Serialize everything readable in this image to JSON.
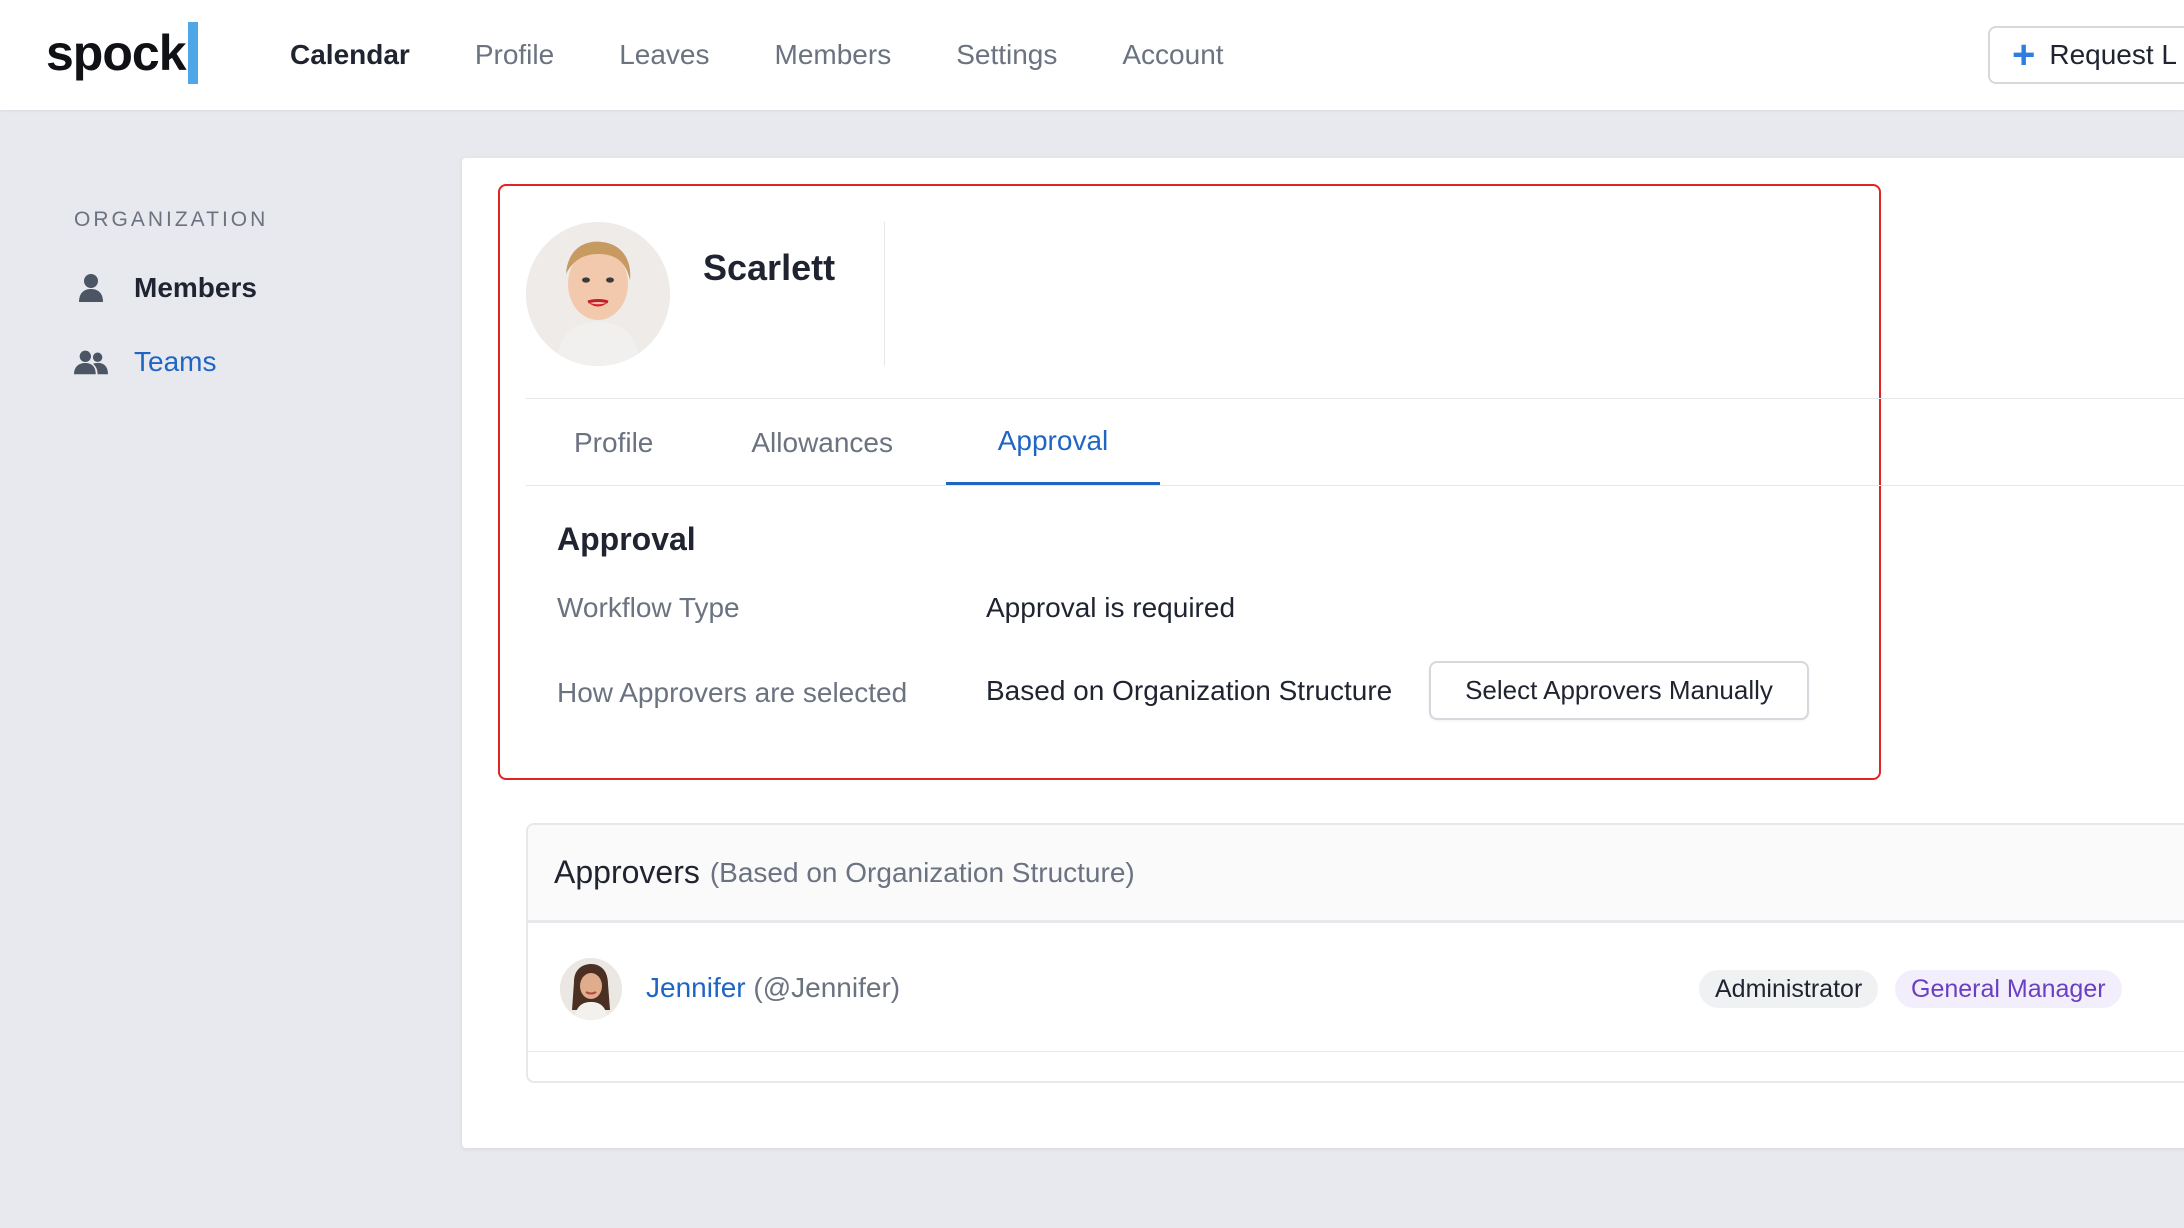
{
  "brand": {
    "name": "spock",
    "accent": "#4fa7e8"
  },
  "nav": {
    "items": [
      "Calendar",
      "Profile",
      "Leaves",
      "Members",
      "Settings",
      "Account"
    ],
    "active": "Calendar",
    "request_button": "Request L"
  },
  "sidebar": {
    "heading": "ORGANIZATION",
    "items": [
      {
        "label": "Members",
        "icon": "user-icon",
        "active": true
      },
      {
        "label": "Teams",
        "icon": "users-icon",
        "active": false
      }
    ]
  },
  "member": {
    "name": "Scarlett"
  },
  "tabs": {
    "items": [
      "Profile",
      "Allowances",
      "Approval"
    ],
    "active": "Approval"
  },
  "approval": {
    "title": "Approval",
    "workflow_label": "Workflow Type",
    "workflow_value": "Approval is required",
    "selection_label": "How Approvers are selected",
    "selection_value": "Based on Organization Structure",
    "manual_button": "Select Approvers Manually"
  },
  "approvers": {
    "title": "Approvers",
    "subtitle": "(Based on Organization Structure)",
    "list": [
      {
        "name": "Jennifer",
        "handle": "(@Jennifer)",
        "badges": [
          "Administrator",
          "General Manager"
        ]
      }
    ]
  },
  "colors": {
    "link": "#1f66c4",
    "highlight": "#e02424",
    "gm_badge": "#6b3fc1"
  }
}
